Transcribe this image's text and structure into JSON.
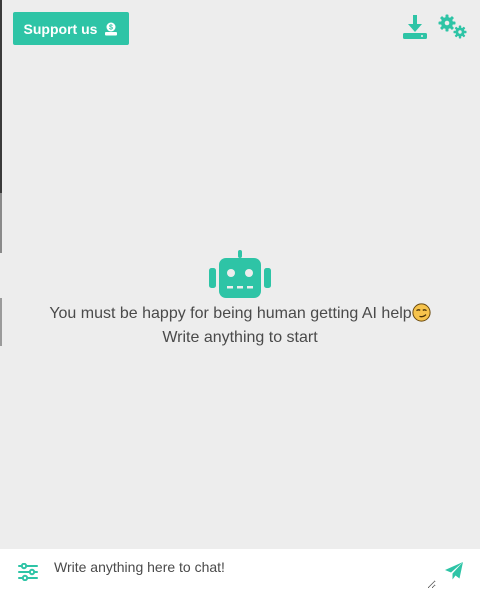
{
  "header": {
    "support_label": "Support us",
    "support_icon": "money-hand-icon",
    "download_icon": "download-icon",
    "settings_icon": "gear-icon"
  },
  "empty_state": {
    "icon": "robot-icon",
    "line1": "You must be happy for being human getting AI help",
    "line1_emoji": "smirking-face-emoji",
    "line2": "Write anything to start"
  },
  "composer": {
    "options_icon": "sliders-icon",
    "placeholder": "Write anything here to chat!",
    "value": "",
    "send_icon": "send-icon"
  },
  "colors": {
    "accent": "#2ec4a6",
    "background": "#ededed",
    "text": "#4a4a4a"
  }
}
